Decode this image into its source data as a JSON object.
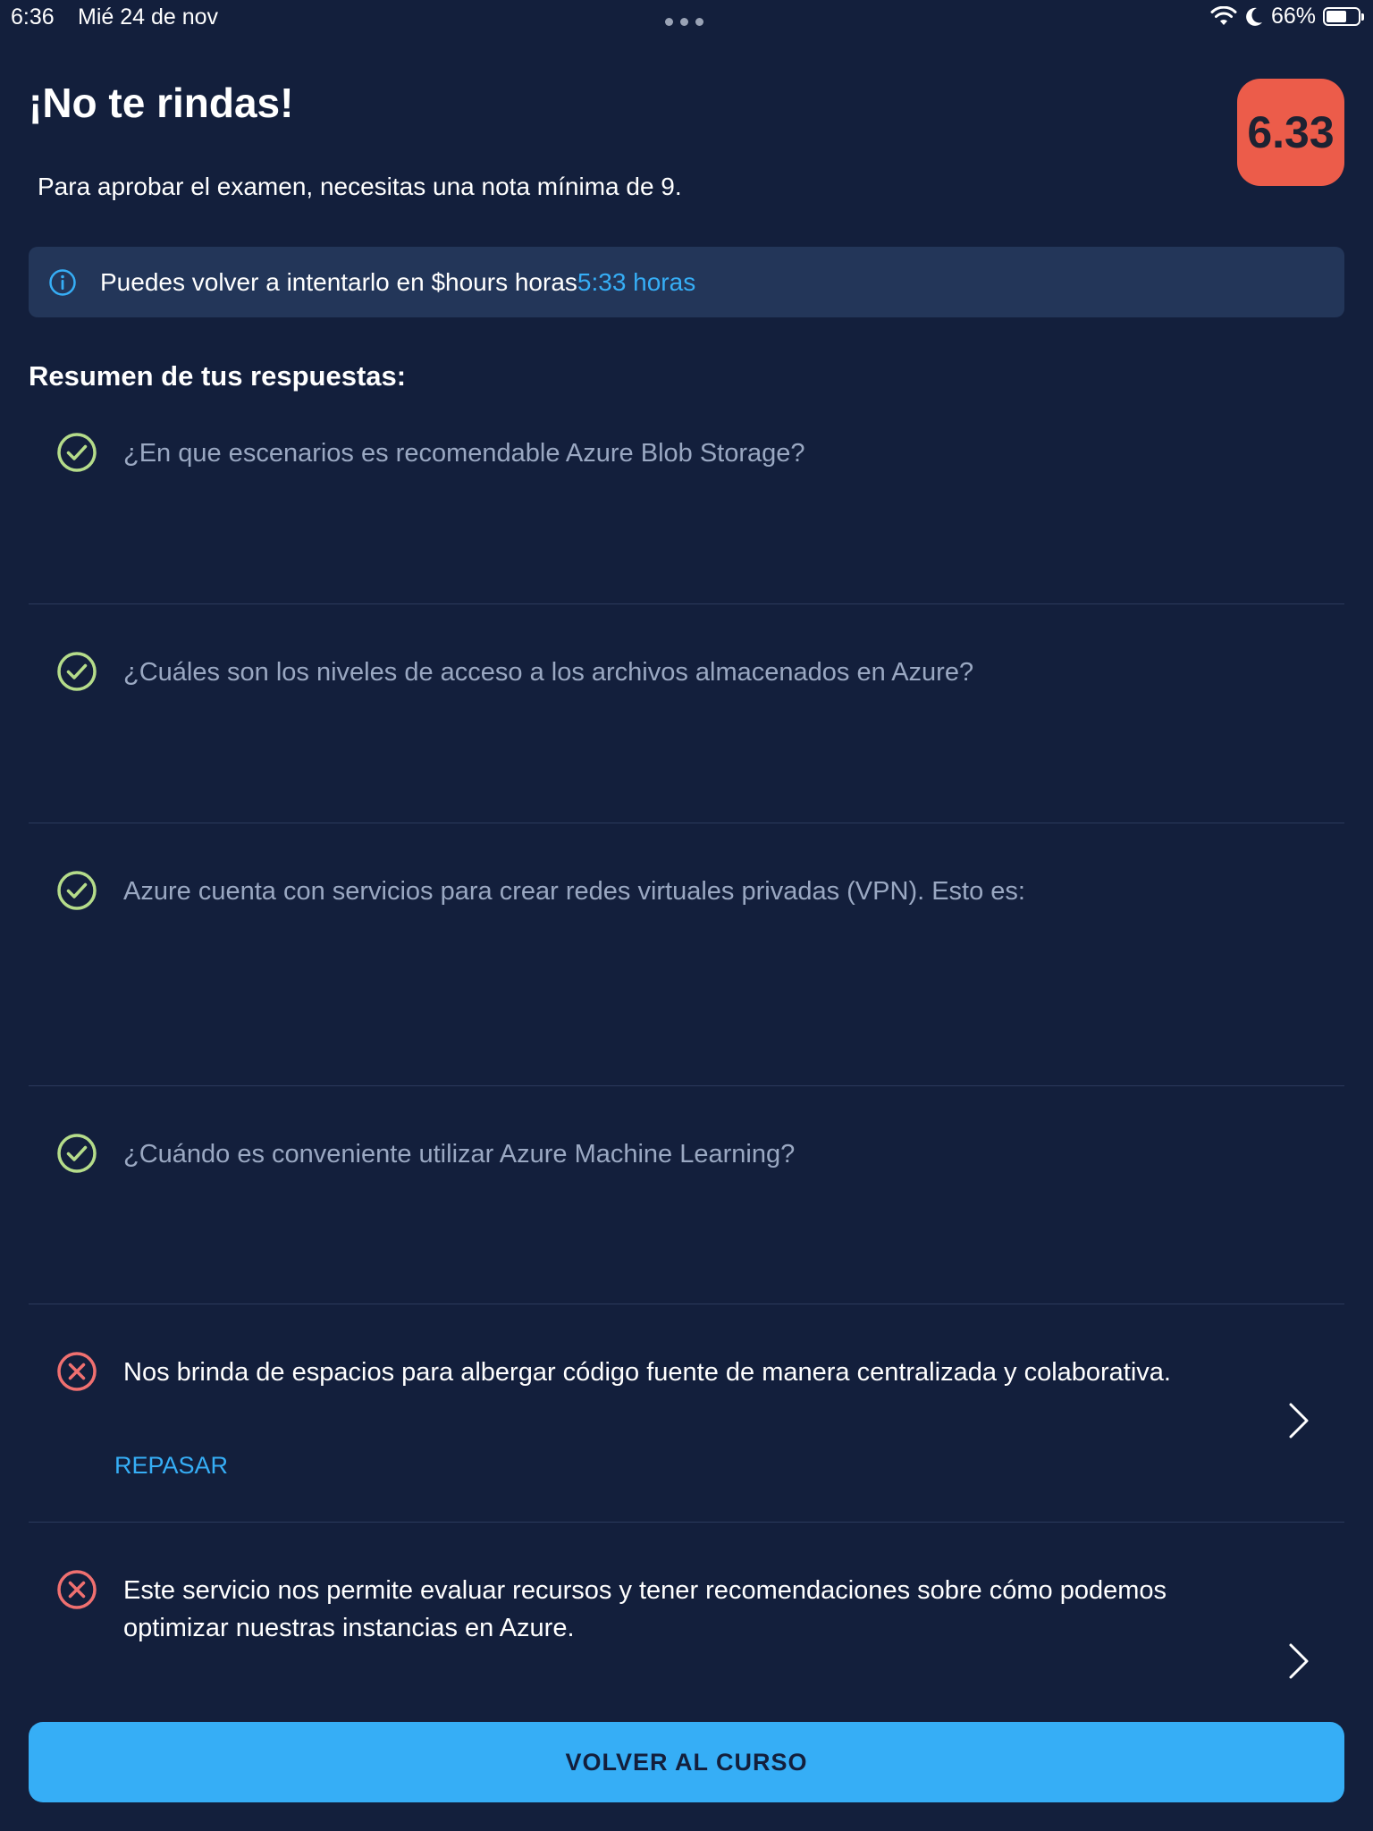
{
  "status_bar": {
    "time": "6:36",
    "date": "Mié 24 de nov",
    "battery": "66%",
    "battery_level": 0.66,
    "icons": [
      "wifi-icon",
      "moon-icon",
      "battery-icon"
    ]
  },
  "header": {
    "title": "¡No te rindas!",
    "subtitle": "Para aprobar el examen, necesitas una nota mínima de 9.",
    "score": "6.33",
    "score_color": "#ec5c4a"
  },
  "info": {
    "icon": "info-icon",
    "text": "Puedes volver a intentarlo en $hours horas",
    "highlight": "5:33 horas"
  },
  "summary": {
    "heading": "Resumen de tus respuestas:",
    "items": [
      {
        "status": "correct",
        "text": "¿En que escenarios es recomendable Azure Blob Storage?"
      },
      {
        "status": "correct",
        "text": "¿Cuáles son los niveles de acceso a los archivos almacenados en Azure?"
      },
      {
        "status": "correct",
        "text": "Azure cuenta con servicios para crear redes virtuales privadas (VPN). Esto es:"
      },
      {
        "status": "correct",
        "text": "¿Cuándo es conveniente utilizar Azure Machine Learning?"
      },
      {
        "status": "wrong",
        "text": "Nos brinda de espacios para albergar código fuente de manera centralizada y colaborativa.",
        "review_label": "REPASAR"
      },
      {
        "status": "wrong",
        "text": "Este servicio nos permite evaluar recursos y tener recomendaciones sobre cómo podemos optimizar nuestras instancias en Azure."
      }
    ]
  },
  "footer": {
    "button_label": "VOLVER AL CURSO"
  },
  "colors": {
    "background": "#131f3c",
    "accent": "#36aef6",
    "correct": "#b5dc8a",
    "wrong": "#f07070"
  }
}
